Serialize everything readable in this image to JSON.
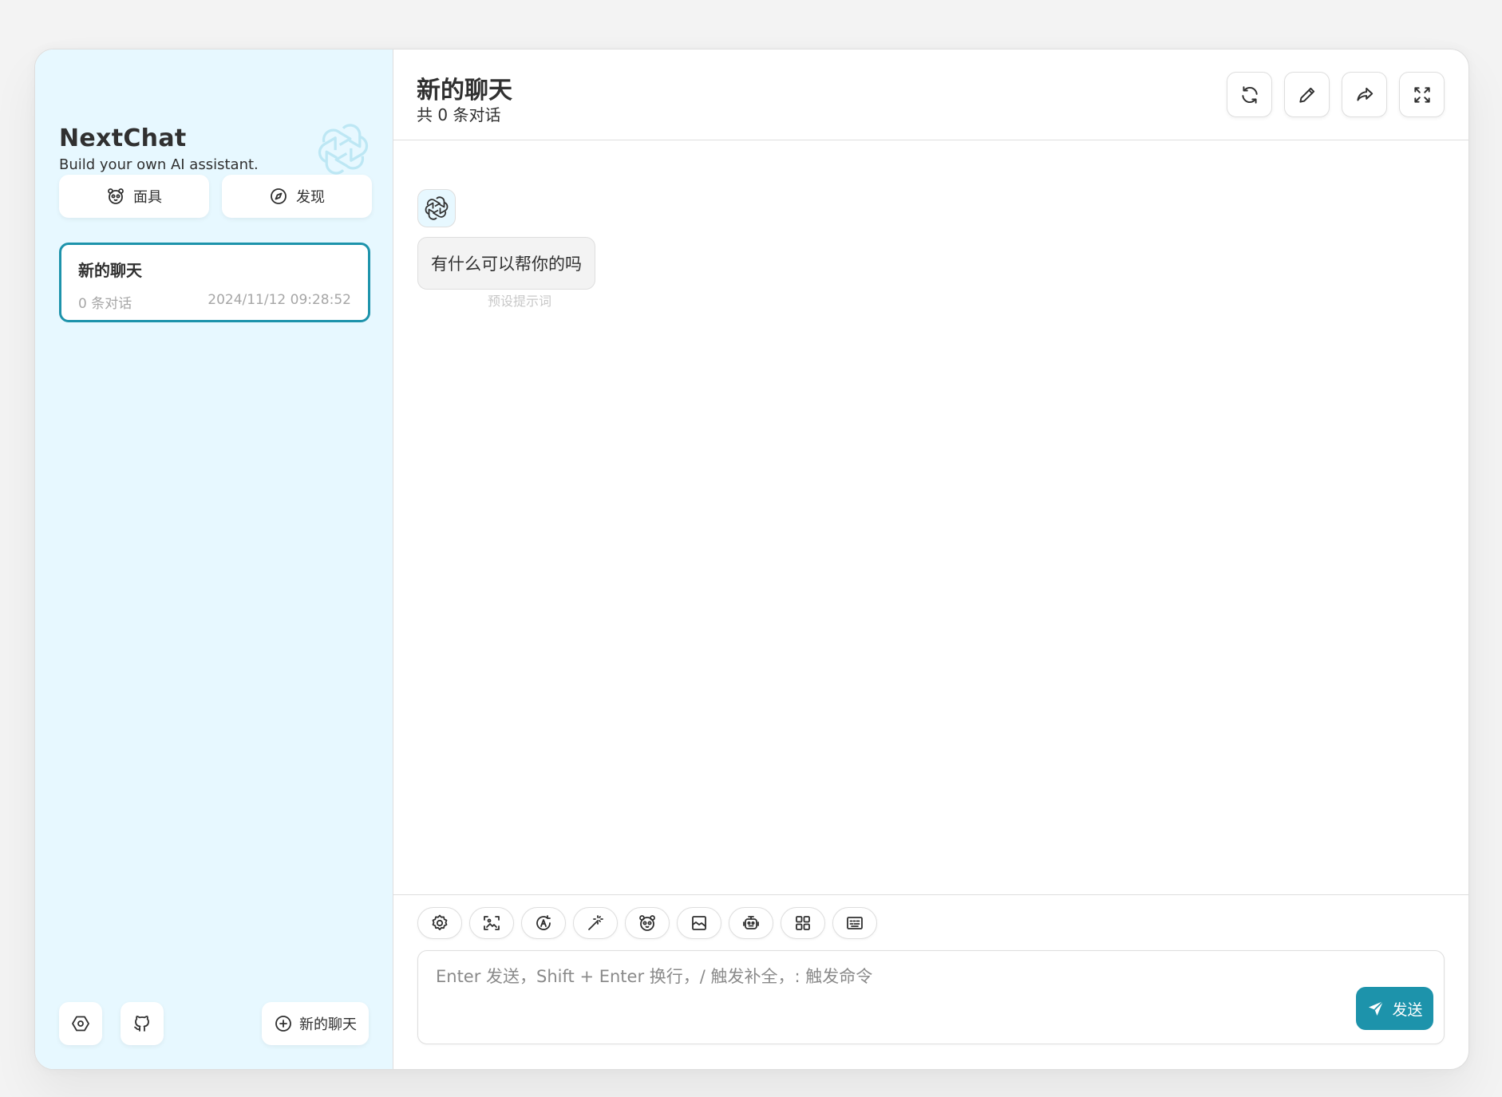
{
  "sidebar": {
    "title": "NextChat",
    "subtitle": "Build your own AI assistant.",
    "logo_icon": "openai-logo-icon",
    "mask_button_label": "面具",
    "discover_button_label": "发现",
    "chats": [
      {
        "title": "新的聊天",
        "count": "0 条对话",
        "time": "2024/11/12 09:28:52"
      }
    ],
    "settings_icon": "settings-icon",
    "github_icon": "github-icon",
    "new_chat_label": "新的聊天"
  },
  "header": {
    "title": "新的聊天",
    "subtitle": "共 0 条对话",
    "actions": [
      "reload-icon",
      "edit-icon",
      "share-icon",
      "fullscreen-icon"
    ]
  },
  "messages": [
    {
      "role": "assistant",
      "text": "有什么可以帮你的吗",
      "note": "预设提示词"
    }
  ],
  "composer": {
    "tools": [
      "settings-icon",
      "image-upload-icon",
      "model-switch-icon",
      "magic-wand-icon",
      "mask-icon",
      "image-icon",
      "robot-icon",
      "plugin-grid-icon",
      "shortcut-keyboard-icon"
    ],
    "placeholder": "Enter 发送，Shift + Enter 换行，/ 触发补全，: 触发命令",
    "send_label": "发送"
  },
  "colors": {
    "accent": "#1d93ab",
    "sidebar_bg": "#e7f8ff",
    "bubble_bg": "#f3f3f3",
    "border": "#dedede"
  }
}
